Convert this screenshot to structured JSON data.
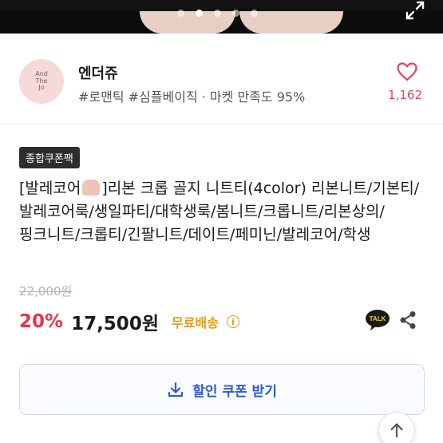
{
  "carousel": {
    "dot_count": 5,
    "active_index": 1
  },
  "shop": {
    "avatar_text": [
      "And",
      "The",
      "Jo"
    ],
    "name": "엔더쥬",
    "tags": "#로맨틱 #심플베이직 · 마켓 만족도 95%",
    "like_count": "1,162"
  },
  "product": {
    "badge": "종합쿠폰팩",
    "title_prefix": "[발레코어",
    "title_rest": "]리본 크롭 골지 니트티(4color)   리본니트/기본티/발레코어룩/생일파티/대학생룩/봄니트/크롭니트/리본상의/핑크니트/크롭티/긴팔니트/데이트/페미닌/발레코어/학생",
    "original_price": "22,000원",
    "discount": "20%",
    "price": "17,500원",
    "shipping": "무료배송",
    "info_icon": "i"
  },
  "actions": {
    "talk_label": "TALK",
    "coupon_button": "할인 쿠폰 받기"
  },
  "colors": {
    "discount": "#e8344e",
    "shipping": "#e39a12",
    "coupon": "#2b5bd7",
    "heart": "#e0465a"
  }
}
